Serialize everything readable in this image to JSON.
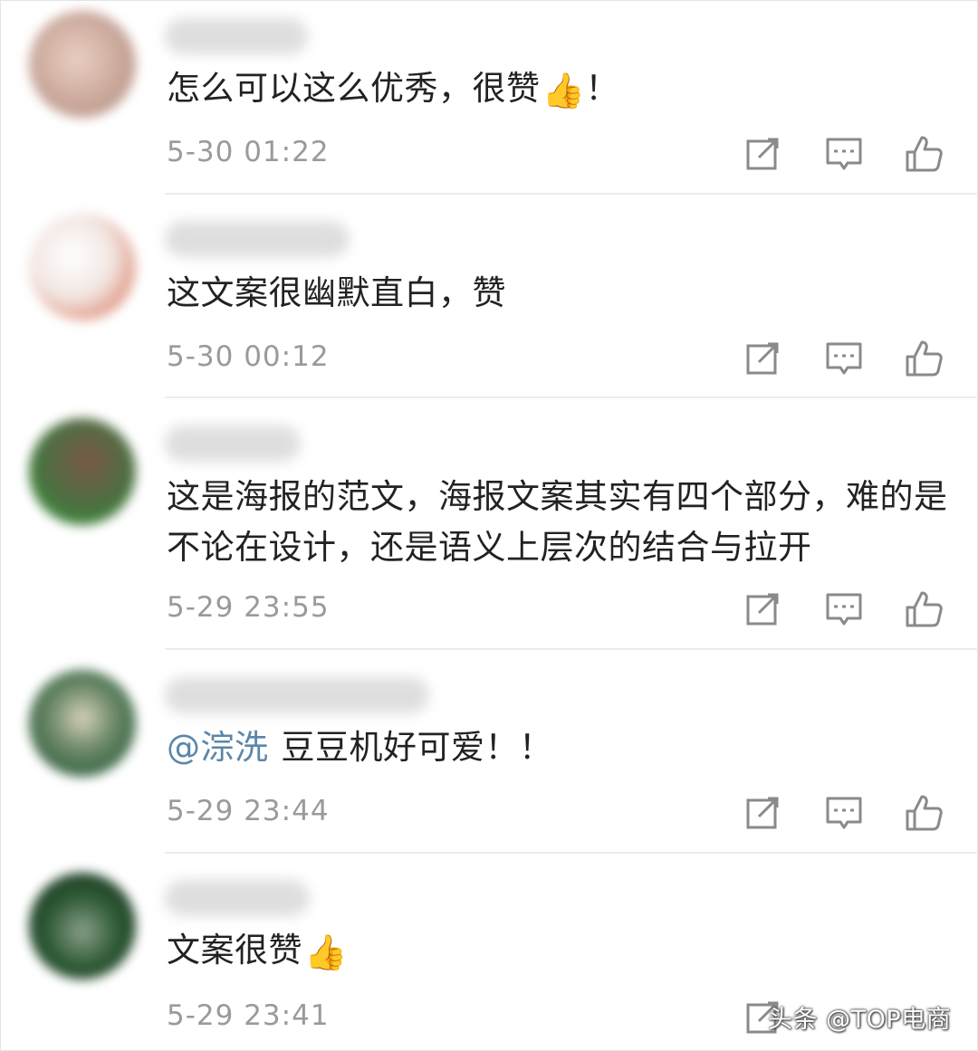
{
  "comments": [
    {
      "text": "怎么可以这么优秀，很赞",
      "emoji": "👍",
      "suffix": "！",
      "time": "5-30 01:22",
      "avatar_color": "#c9a79a"
    },
    {
      "text": "这文案很幽默直白，赞",
      "time": "5-30 00:12",
      "avatar_color": "#e8b8a8"
    },
    {
      "text": "这是海报的范文，海报文案其实有四个部分，难的是不论在设计，还是语义上层次的结合与拉开",
      "time": "5-29 23:55",
      "avatar_color": "#5a7a50"
    },
    {
      "mention": "@淙洗",
      "text": "豆豆机好可爱！！",
      "time": "5-29 23:44",
      "avatar_color": "#3f6e4a"
    },
    {
      "text": "文案很赞",
      "emoji": "👍",
      "time": "5-29 23:41",
      "avatar_color": "#1f4a2a"
    }
  ],
  "icons": {
    "share": "share-icon",
    "reply": "comment-icon",
    "like": "thumbs-up-icon"
  },
  "colors": {
    "text": "#222222",
    "time": "#9a9a9a",
    "mention": "#5b86a8",
    "icon": "#8a8a8a",
    "divider": "#ececec"
  },
  "watermark": "头条 @TOP电商"
}
